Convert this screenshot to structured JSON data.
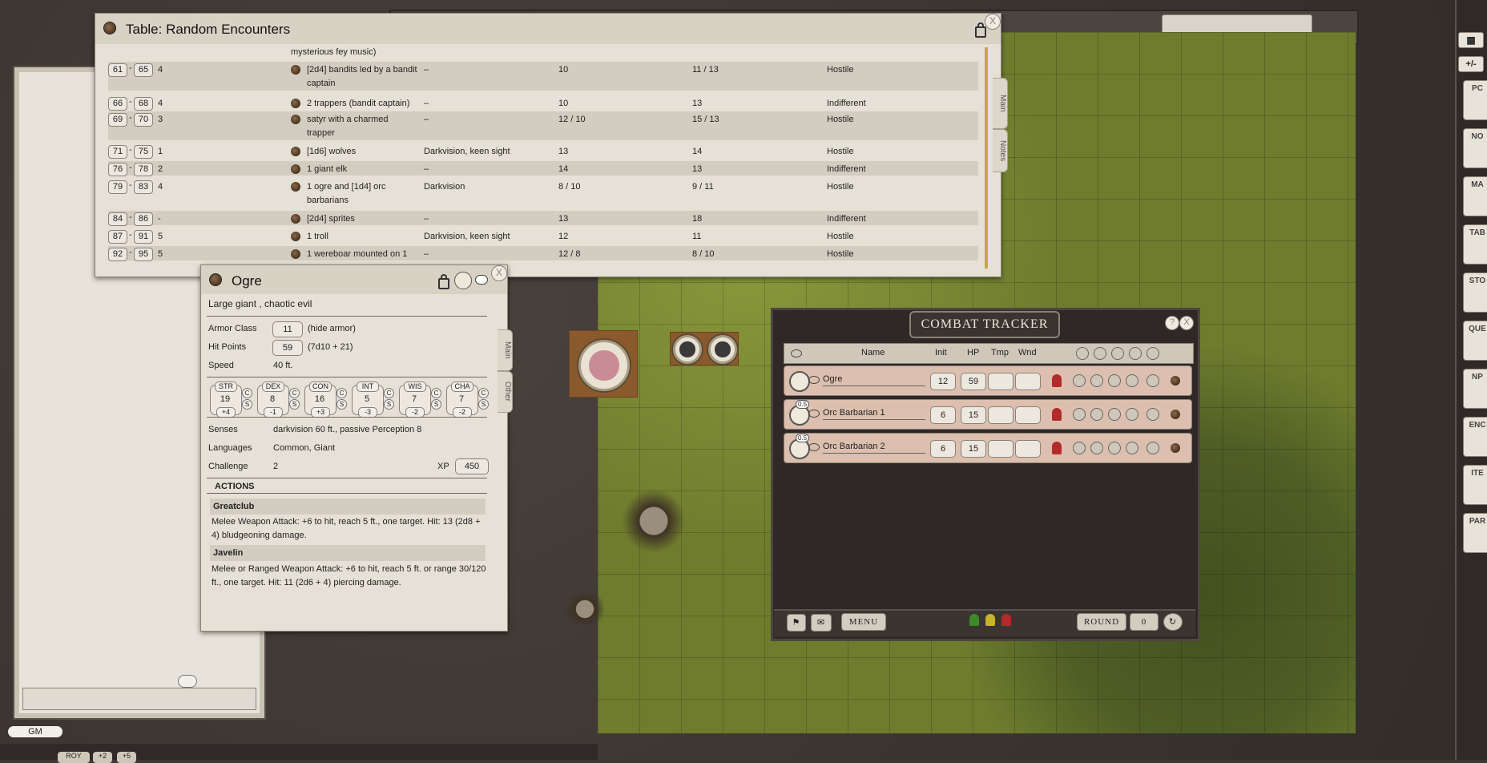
{
  "random_table": {
    "title": "Table: Random Encounters",
    "tabs": [
      "Main",
      "Notes"
    ],
    "top_fragment": "mysterious fey music)",
    "rows": [
      {
        "from": "61",
        "to": "65",
        "num": "4",
        "creature": "[2d4] bandits led by a bandit",
        "creature2": "captain",
        "senses": "–",
        "ac": "10",
        "hp": "11 / 13",
        "attitude": "Hostile"
      },
      {
        "from": "66",
        "to": "68",
        "num": "4",
        "creature": "2 trappers (bandit captain)",
        "creature2": "",
        "senses": "–",
        "ac": "10",
        "hp": "13",
        "attitude": "Indifferent"
      },
      {
        "from": "69",
        "to": "70",
        "num": "3",
        "creature": "satyr with a charmed",
        "creature2": "trapper",
        "senses": "–",
        "ac": "12 / 10",
        "hp": "15 / 13",
        "attitude": "Hostile"
      },
      {
        "from": "71",
        "to": "75",
        "num": "1",
        "creature": "[1d6] wolves",
        "creature2": "",
        "senses": "Darkvision, keen sight",
        "ac": "13",
        "hp": "14",
        "attitude": "Hostile"
      },
      {
        "from": "76",
        "to": "78",
        "num": "2",
        "creature": "1 giant elk",
        "creature2": "",
        "senses": "–",
        "ac": "14",
        "hp": "13",
        "attitude": "Indifferent"
      },
      {
        "from": "79",
        "to": "83",
        "num": "4",
        "creature": "1 ogre and [1d4] orc",
        "creature2": "barbarians",
        "senses": "Darkvision",
        "ac": "8 / 10",
        "hp": "9 / 11",
        "attitude": "Hostile"
      },
      {
        "from": "84",
        "to": "86",
        "num": "-",
        "creature": "[2d4] sprites",
        "creature2": "",
        "senses": "–",
        "ac": "13",
        "hp": "18",
        "attitude": "Indifferent"
      },
      {
        "from": "87",
        "to": "91",
        "num": "5",
        "creature": "1 troll",
        "creature2": "",
        "senses": "Darkvision, keen sight",
        "ac": "12",
        "hp": "11",
        "attitude": "Hostile"
      },
      {
        "from": "92",
        "to": "95",
        "num": "5",
        "creature": "1 wereboar mounted on 1",
        "creature2": "",
        "senses": "–",
        "ac": "12 / 8",
        "hp": "8 / 10",
        "attitude": "Hostile"
      }
    ]
  },
  "ogre": {
    "name": "Ogre",
    "type_line": "Large giant , chaotic evil",
    "tabs": [
      "Main",
      "Other"
    ],
    "armor_class_label": "Armor Class",
    "armor_class": "11",
    "armor_note": "(hide armor)",
    "hit_points_label": "Hit Points",
    "hit_points": "59",
    "hit_dice": "(7d10 + 21)",
    "speed_label": "Speed",
    "speed": "40 ft.",
    "abilities": [
      {
        "name": "STR",
        "score": "19",
        "mod": "+4"
      },
      {
        "name": "DEX",
        "score": "8",
        "mod": "-1"
      },
      {
        "name": "CON",
        "score": "16",
        "mod": "+3"
      },
      {
        "name": "INT",
        "score": "5",
        "mod": "-3"
      },
      {
        "name": "WIS",
        "score": "7",
        "mod": "-2"
      },
      {
        "name": "CHA",
        "score": "7",
        "mod": "-2"
      }
    ],
    "check_label": "C",
    "save_label": "S",
    "senses_label": "Senses",
    "senses": "darkvision 60 ft., passive Perception 8",
    "languages_label": "Languages",
    "languages": "Common, Giant",
    "challenge_label": "Challenge",
    "challenge": "2",
    "xp_label": "XP",
    "xp": "450",
    "actions_header": "ACTIONS",
    "actions": [
      {
        "name": "Greatclub",
        "text": "Melee Weapon Attack: +6 to hit, reach 5 ft., one target. Hit: 13 (2d8 + 4) bludgeoning damage."
      },
      {
        "name": "Javelin",
        "text": "Melee or Ranged Weapon Attack: +6 to hit, reach 5 ft. or range 30/120 ft., one target. Hit: 11 (2d6 + 4) piercing damage."
      }
    ]
  },
  "combat_tracker": {
    "title": "COMBAT TRACKER",
    "help_label": "?",
    "close_label": "X",
    "headers": {
      "name": "Name",
      "init": "Init",
      "hp": "HP",
      "tmp": "Tmp",
      "wnd": "Wnd"
    },
    "rows": [
      {
        "name": "Ogre",
        "init": "12",
        "hp": "59",
        "tmp": "",
        "wnd": "",
        "size_badge": ""
      },
      {
        "name": "Orc Barbarian 1",
        "init": "6",
        "hp": "15",
        "tmp": "",
        "wnd": "",
        "size_badge": "0.5"
      },
      {
        "name": "Orc Barbarian 2",
        "init": "6",
        "hp": "15",
        "tmp": "",
        "wnd": "",
        "size_badge": "0.5"
      }
    ],
    "menu_label": "MENU",
    "round_label": "ROUND",
    "round_value": "0",
    "status_colors": {
      "friendly": "#3c8a2a",
      "neutral": "#c9b32a",
      "hostile": "#b32a2a"
    }
  },
  "chat": {
    "gm_label": "GM"
  },
  "sidebar": {
    "top_labels": [
      "+/-"
    ],
    "buttons": [
      "PC",
      "NO",
      "MA",
      "TAB",
      "STO",
      "QUE",
      "NP",
      "ENC",
      "ITE",
      "PAR"
    ]
  },
  "hotkeys": [
    "ROY",
    "+2",
    "+5"
  ]
}
